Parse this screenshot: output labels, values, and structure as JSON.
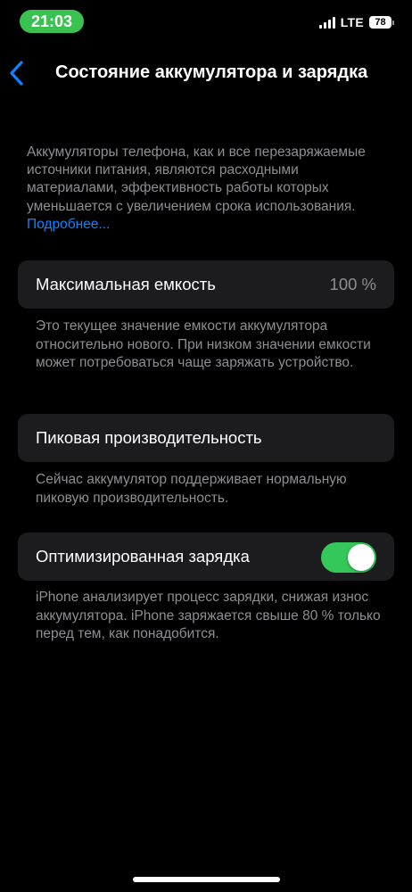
{
  "status_bar": {
    "time": "21:03",
    "network": "LTE",
    "battery_level": "78",
    "time_pill_color": "#39c24f"
  },
  "nav": {
    "back_icon": "chevron-left-icon",
    "title": "Состояние аккумулятора и зарядка"
  },
  "intro": {
    "text": "Аккумуляторы телефона, как и все перезаряжаемые источники питания, являются расходными материалами, эффективность работы которых уменьшается с увеличением срока использования.",
    "link": "Подробнее..."
  },
  "max_capacity": {
    "label": "Максимальная емкость",
    "value": "100 %",
    "footnote": "Это текущее значение емкости аккумулятора относительно нового. При низком значении емкости может потребоваться чаще заряжать устройство."
  },
  "peak_performance": {
    "label": "Пиковая производительность",
    "footnote": "Сейчас аккумулятор поддерживает нормальную пиковую производительность."
  },
  "optimized_charging": {
    "label": "Оптимизированная зарядка",
    "enabled": true,
    "footnote": "iPhone анализирует процесс зарядки, снижая износ аккумулятора. iPhone заряжается свыше 80 % только перед тем, как понадобится."
  },
  "colors": {
    "accent": "#0a84ff",
    "toggle_on": "#34c759",
    "card_bg": "#1c1c1e",
    "secondary_text": "#8e8e93"
  }
}
